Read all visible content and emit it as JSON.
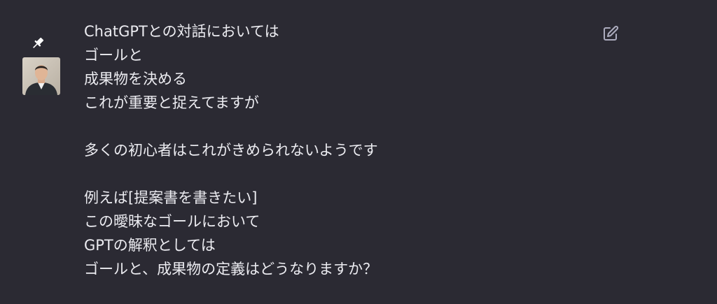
{
  "icons": {
    "pin": "pin-icon",
    "edit": "edit-icon",
    "avatar": "user-avatar"
  },
  "colors": {
    "background": "#2b2a33",
    "text": "#ececf1",
    "icon": "#acacbe"
  },
  "message": {
    "lines": [
      "ChatGPTとの対話においては",
      "ゴールと",
      "成果物を決める",
      "これが重要と捉えてますが",
      "",
      "多くの初心者はこれがきめられないようです",
      "",
      "例えば[提案書を書きたい]",
      "この曖昧なゴールにおいて",
      "GPTの解釈としては",
      "ゴールと、成果物の定義はどうなりますか？"
    ]
  }
}
